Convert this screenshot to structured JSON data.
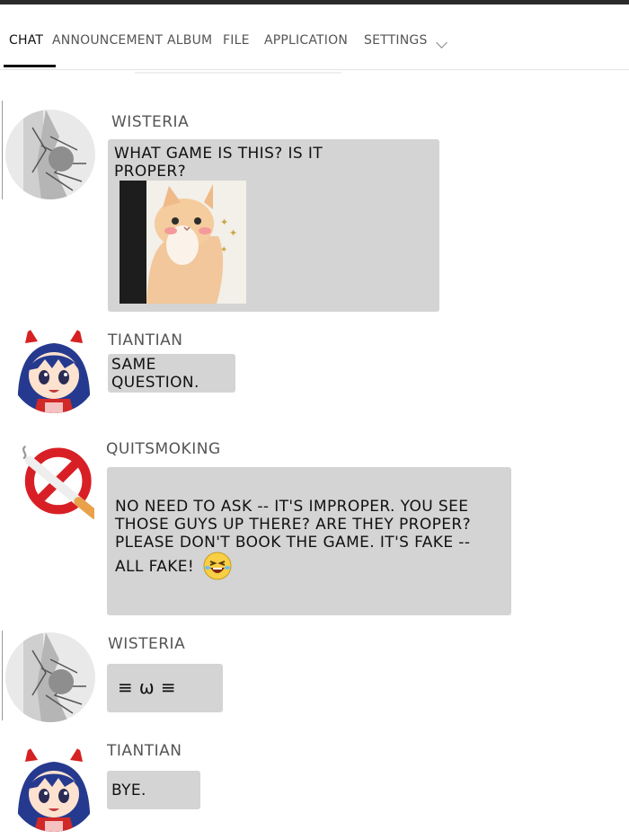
{
  "tabs": {
    "items": [
      "CHAT",
      "ANNOUNCEMENT",
      "ALBUM",
      "FILE",
      "APPLICATION",
      "SETTINGS"
    ],
    "active": "CHAT",
    "settings_icon": "chevron-down-icon"
  },
  "messages": [
    {
      "sender": "WISTERIA",
      "avatar": "wisteria-avatar",
      "text": "WHAT GAME IS THIS? IS IT PROPER?",
      "image": "cat-photo"
    },
    {
      "sender": "TIANTIAN",
      "avatar": "tiantian-avatar",
      "text": "SAME QUESTION."
    },
    {
      "sender": "QUITSMOKING",
      "avatar": "no-smoking-avatar",
      "text": "NO NEED TO ASK -- IT'S IMPROPER. YOU SEE THOSE GUYS UP THERE? ARE THEY PROPER? PLEASE DON'T BOOK THE GAME. IT'S FAKE -- ALL FAKE!",
      "emoji": "laughing-crying-emoji"
    },
    {
      "sender": "WISTERIA",
      "avatar": "wisteria-avatar",
      "text": "≡ ω ≡"
    },
    {
      "sender": "TIANTIAN",
      "avatar": "tiantian-avatar",
      "text": "BYE."
    }
  ],
  "colors": {
    "bubble": "#d4d4d4",
    "background": "#ffffff",
    "tab_active": "#111111"
  }
}
